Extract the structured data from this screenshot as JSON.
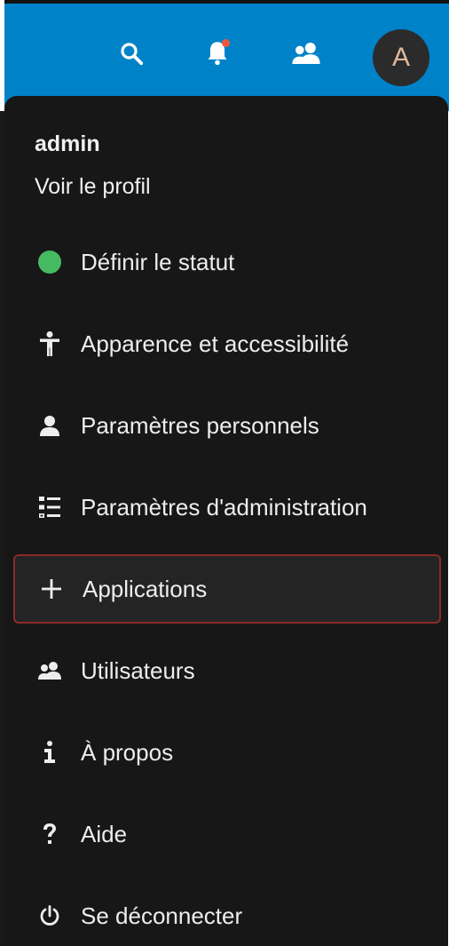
{
  "header": {
    "avatar_letter": "A",
    "icons": [
      "search-icon",
      "notifications-icon",
      "contacts-icon"
    ]
  },
  "menu": {
    "user_name": "admin",
    "profile_link": "Voir le profil",
    "items": [
      {
        "label": "Définir le statut",
        "icon": "status-dot-icon",
        "status_color": "#46ba61"
      },
      {
        "label": "Apparence et accessibilité",
        "icon": "accessibility-icon"
      },
      {
        "label": "Paramètres personnels",
        "icon": "user-icon"
      },
      {
        "label": "Paramètres d'administration",
        "icon": "list-settings-icon"
      },
      {
        "label": "Applications",
        "icon": "plus-icon",
        "active": true
      },
      {
        "label": "Utilisateurs",
        "icon": "users-icon"
      },
      {
        "label": "À propos",
        "icon": "info-icon"
      },
      {
        "label": "Aide",
        "icon": "help-icon"
      },
      {
        "label": "Se déconnecter",
        "icon": "power-icon"
      }
    ]
  },
  "colors": {
    "header_bg": "#0082c9",
    "menu_bg": "#171717",
    "status_online": "#46ba61",
    "notification_dot": "#ef5a3a",
    "active_border": "#8a2a2a"
  }
}
